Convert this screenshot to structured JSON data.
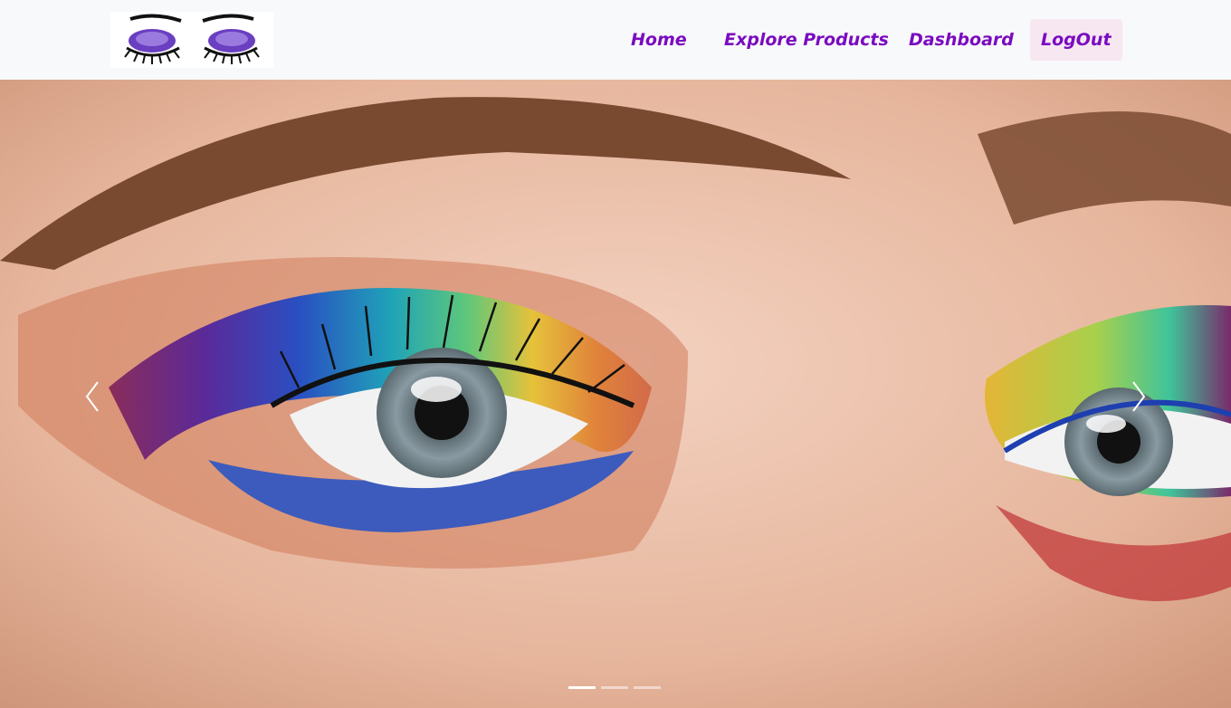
{
  "navbar": {
    "logo_alt": "eyes-logo",
    "links": [
      {
        "label": "Home"
      },
      {
        "label": "Explore Products"
      },
      {
        "label": "Dashboard"
      },
      {
        "label": "LogOut"
      }
    ],
    "link_color": "#7a0bc0",
    "active_bg": "#f6e7f1"
  },
  "carousel": {
    "slide_count": 3,
    "active_slide": 1,
    "prev_icon": "chevron-left-icon",
    "next_icon": "chevron-right-icon",
    "slide_subject": "close-up of rainbow eyeshadow makeup"
  }
}
